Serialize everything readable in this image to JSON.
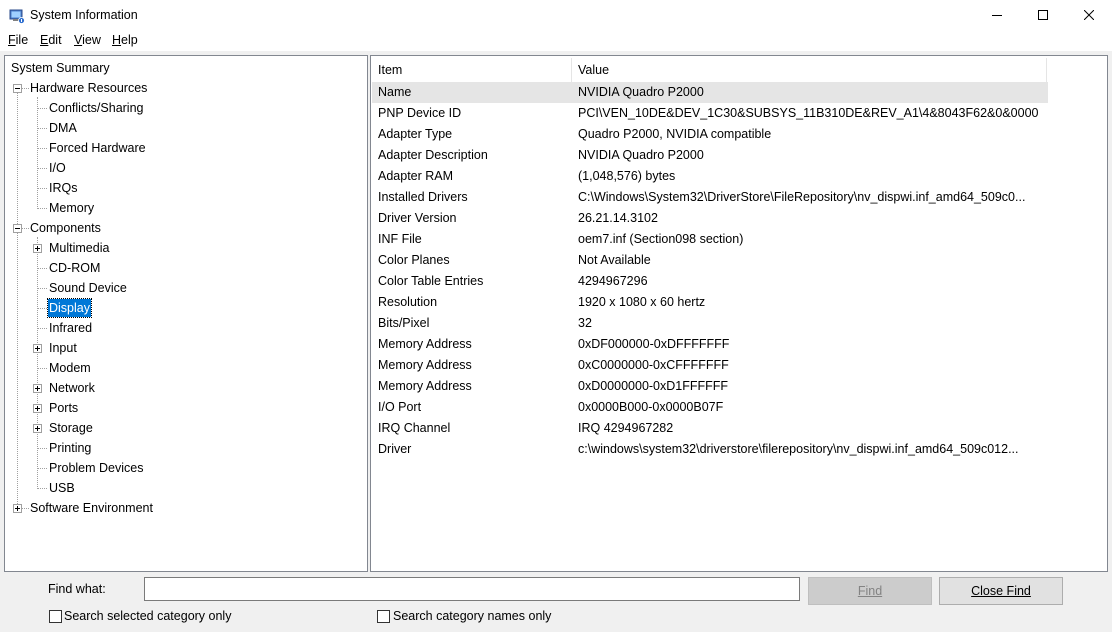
{
  "window": {
    "title": "System Information",
    "icon": "system-information-icon"
  },
  "menu": [
    {
      "label": "File",
      "accel": "F",
      "rest": "ile"
    },
    {
      "label": "Edit",
      "accel": "E",
      "rest": "dit"
    },
    {
      "label": "View",
      "accel": "V",
      "rest": "iew"
    },
    {
      "label": "Help",
      "accel": "H",
      "rest": "elp"
    }
  ],
  "tree": {
    "root": "System Summary",
    "hardware": {
      "label": "Hardware Resources",
      "children": [
        "Conflicts/Sharing",
        "DMA",
        "Forced Hardware",
        "I/O",
        "IRQs",
        "Memory"
      ]
    },
    "components": {
      "label": "Components",
      "children": [
        {
          "label": "Multimedia",
          "expandable": true
        },
        {
          "label": "CD-ROM",
          "expandable": false
        },
        {
          "label": "Sound Device",
          "expandable": false
        },
        {
          "label": "Display",
          "expandable": false,
          "selected": true
        },
        {
          "label": "Infrared",
          "expandable": false
        },
        {
          "label": "Input",
          "expandable": true
        },
        {
          "label": "Modem",
          "expandable": false
        },
        {
          "label": "Network",
          "expandable": true
        },
        {
          "label": "Ports",
          "expandable": true
        },
        {
          "label": "Storage",
          "expandable": true
        },
        {
          "label": "Printing",
          "expandable": false
        },
        {
          "label": "Problem Devices",
          "expandable": false
        },
        {
          "label": "USB",
          "expandable": false
        }
      ]
    },
    "software": {
      "label": "Software Environment"
    }
  },
  "list": {
    "columns": {
      "item": "Item",
      "value": "Value"
    },
    "rows": [
      [
        "Name",
        "NVIDIA Quadro P2000"
      ],
      [
        "PNP Device ID",
        "PCI\\VEN_10DE&DEV_1C30&SUBSYS_11B310DE&REV_A1\\4&8043F62&0&0000"
      ],
      [
        "Adapter Type",
        "Quadro P2000, NVIDIA compatible"
      ],
      [
        "Adapter Description",
        "NVIDIA Quadro P2000"
      ],
      [
        "Adapter RAM",
        "(1,048,576) bytes"
      ],
      [
        "Installed Drivers",
        "C:\\Windows\\System32\\DriverStore\\FileRepository\\nv_dispwi.inf_amd64_509c0..."
      ],
      [
        "Driver Version",
        "26.21.14.3102"
      ],
      [
        "INF File",
        "oem7.inf (Section098 section)"
      ],
      [
        "Color Planes",
        "Not Available"
      ],
      [
        "Color Table Entries",
        "4294967296"
      ],
      [
        "Resolution",
        "1920 x 1080 x 60 hertz"
      ],
      [
        "Bits/Pixel",
        "32"
      ],
      [
        "Memory Address",
        "0xDF000000-0xDFFFFFFF"
      ],
      [
        "Memory Address",
        "0xC0000000-0xCFFFFFFF"
      ],
      [
        "Memory Address",
        "0xD0000000-0xD1FFFFFF"
      ],
      [
        "I/O Port",
        "0x0000B000-0x0000B07F"
      ],
      [
        "IRQ Channel",
        "IRQ 4294967282"
      ],
      [
        "Driver",
        "c:\\windows\\system32\\driverstore\\filerepository\\nv_dispwi.inf_amd64_509c012..."
      ]
    ]
  },
  "find": {
    "label": "Find what:",
    "label_accel": "w",
    "value": "",
    "find_button": "Find",
    "close_button": "Close Find",
    "search_selected": "Search selected category only",
    "search_names": "Search category names only"
  },
  "colors": {
    "selection": "#0078d7",
    "window_bg": "#f0f0f0"
  }
}
